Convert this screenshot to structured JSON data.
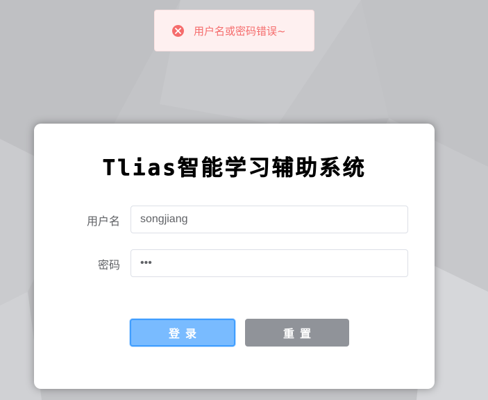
{
  "toast": {
    "icon": "close-circle-icon",
    "message": "用户名或密码错误~",
    "color": "#f56c6c"
  },
  "login": {
    "title": "Tlias智能学习辅助系统",
    "username_label": "用户名",
    "username_value": "songjiang",
    "password_label": "密码",
    "password_value": "•••",
    "login_button": "登录",
    "reset_button": "重置"
  },
  "colors": {
    "login_button": "#79bbff",
    "reset_button": "#909399",
    "background": "#c4c5c8"
  }
}
